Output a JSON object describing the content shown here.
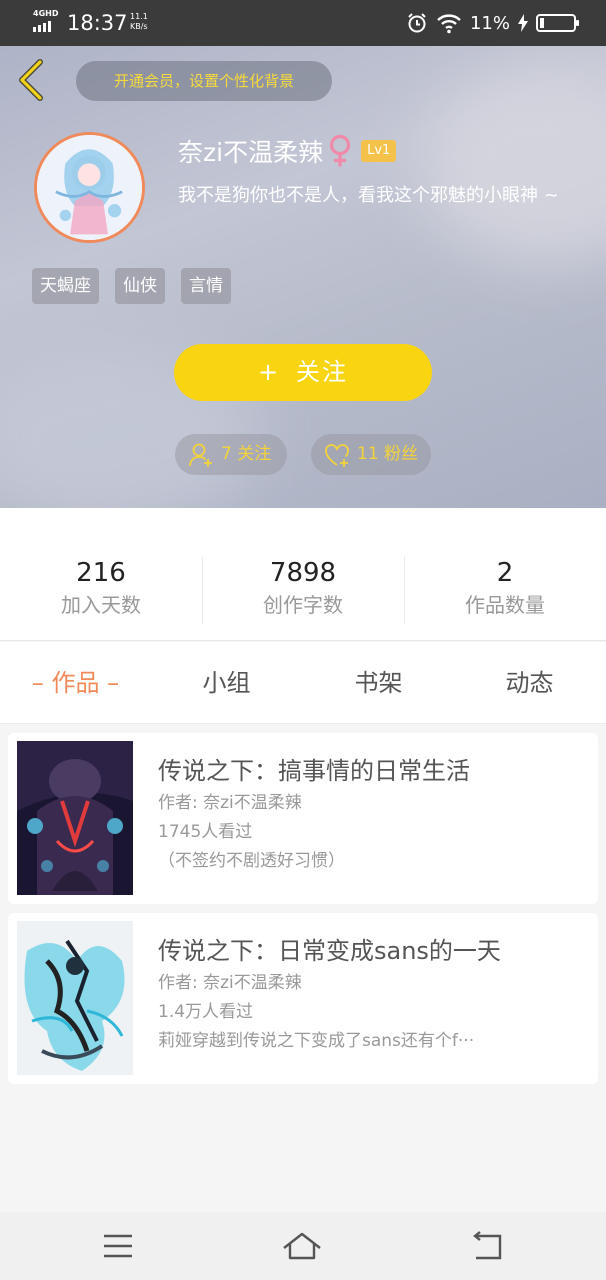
{
  "status_bar": {
    "network": "4GHD",
    "time": "18:37",
    "speed_value": "11.1",
    "speed_unit": "KB/s",
    "battery_percent": "11%",
    "battery_level": 0.11
  },
  "header": {
    "vip_banner": "开通会员，设置个性化背景",
    "username": "奈zi不温柔辣",
    "level": "Lv1",
    "bio": "我不是狗你也不是人，看我这个邪魅的小眼神 ~",
    "tags": [
      "天蝎座",
      "仙侠",
      "言情"
    ],
    "follow_plus": "+",
    "follow_label": "关注",
    "following_label": "7 关注",
    "fans_label": "11 粉丝",
    "accent_color": "#f8d411"
  },
  "stats": [
    {
      "value": "216",
      "label": "加入天数"
    },
    {
      "value": "7898",
      "label": "创作字数"
    },
    {
      "value": "2",
      "label": "作品数量"
    }
  ],
  "tabs": [
    {
      "label": "– 作品 –",
      "active": true
    },
    {
      "label": "小组",
      "active": false
    },
    {
      "label": "书架",
      "active": false
    },
    {
      "label": "动态",
      "active": false
    }
  ],
  "works": [
    {
      "title": "传说之下：搞事情的日常生活",
      "author": "作者: 奈zi不温柔辣",
      "views": "1745人看过",
      "summary": "（不签约不剧透好习惯）"
    },
    {
      "title": "传说之下：日常变成sans的一天",
      "author": "作者: 奈zi不温柔辣",
      "views": "1.4万人看过",
      "summary": "莉娅穿越到传说之下变成了sans还有个f···"
    }
  ]
}
